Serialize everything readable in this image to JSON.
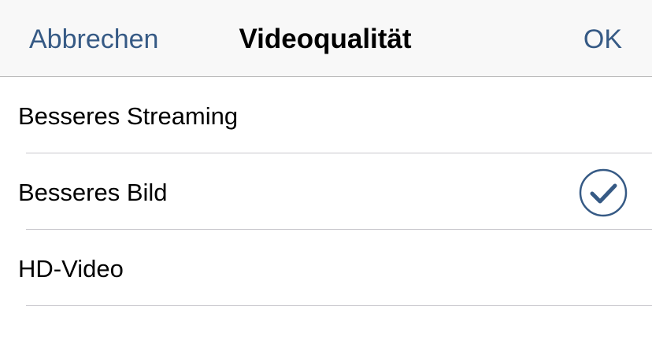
{
  "navbar": {
    "cancel_label": "Abbrechen",
    "title": "Videoqualität",
    "ok_label": "OK"
  },
  "options": [
    {
      "label": "Besseres Streaming",
      "selected": false
    },
    {
      "label": "Besseres Bild",
      "selected": true
    },
    {
      "label": "HD-Video",
      "selected": false
    }
  ],
  "colors": {
    "accent": "#365a85",
    "navbar_bg": "#f8f8f8",
    "separator": "#c8c7cc"
  },
  "icons": {
    "selected_marker": "checkmark-circle-icon"
  }
}
